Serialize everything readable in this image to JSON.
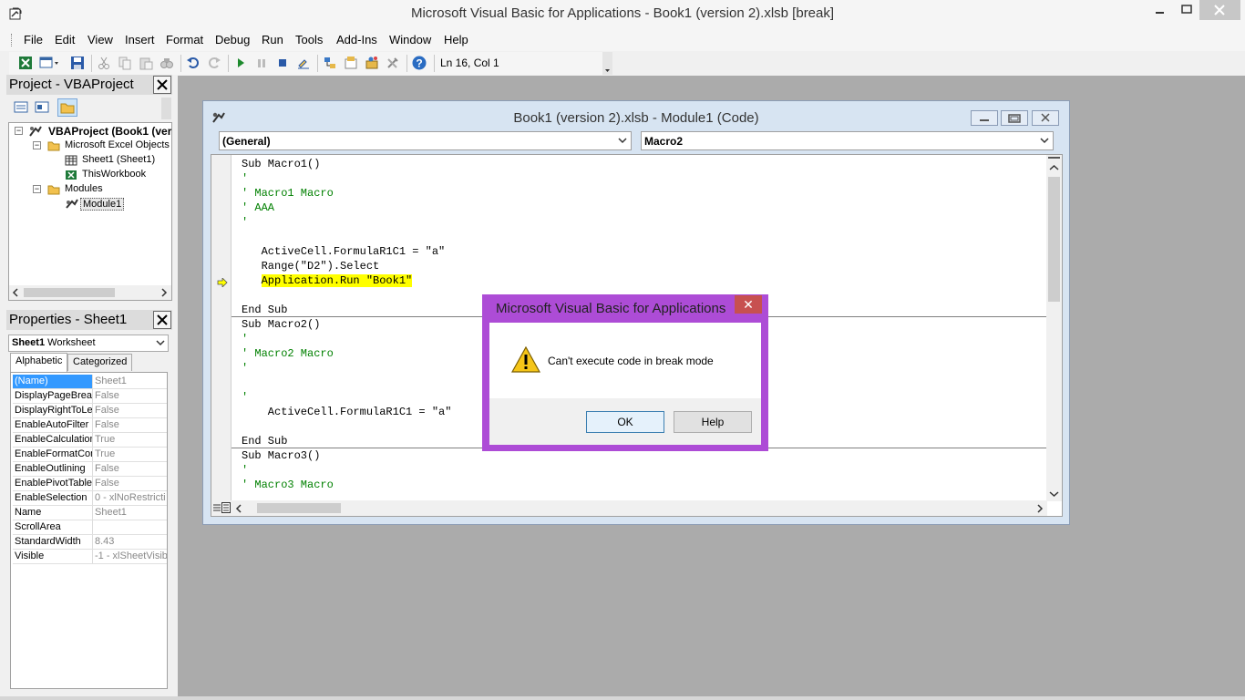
{
  "window": {
    "title": "Microsoft Visual Basic for Applications - Book1 (version 2).xlsb [break]",
    "controls": [
      "minimize",
      "maximize",
      "close"
    ]
  },
  "menu": {
    "items": [
      {
        "label": "File"
      },
      {
        "label": "Edit"
      },
      {
        "label": "View"
      },
      {
        "label": "Insert"
      },
      {
        "label": "Format"
      },
      {
        "label": "Debug"
      },
      {
        "label": "Run"
      },
      {
        "label": "Tools"
      },
      {
        "label": "Add-Ins"
      },
      {
        "label": "Window"
      },
      {
        "label": "Help"
      }
    ]
  },
  "toolbar": {
    "position_text": "Ln 16, Col 1",
    "icons": [
      "excel-icon",
      "insert-module-icon",
      "save-icon",
      "cut-icon",
      "copy-icon",
      "paste-icon",
      "find-icon",
      "undo-icon",
      "redo-icon",
      "run-icon",
      "break-icon",
      "reset-icon",
      "design-mode-icon",
      "project-explorer-icon",
      "properties-icon",
      "object-browser-icon",
      "toolbox-icon",
      "help-icon"
    ]
  },
  "project": {
    "title": "Project - VBAProject",
    "tree": {
      "root": "VBAProject (Book1 (ver",
      "excel_objects": "Microsoft Excel Objects",
      "sheet1": "Sheet1 (Sheet1)",
      "thisworkbook": "ThisWorkbook",
      "modules": "Modules",
      "module1": "Module1"
    }
  },
  "properties": {
    "title": "Properties - Sheet1",
    "object_name": "Sheet1",
    "object_type": "Worksheet",
    "tabs": [
      "Alphabetic",
      "Categorized"
    ],
    "rows": [
      {
        "name": "(Name)",
        "value": "Sheet1"
      },
      {
        "name": "DisplayPageBreak",
        "value": "False"
      },
      {
        "name": "DisplayRightToLef",
        "value": "False"
      },
      {
        "name": "EnableAutoFilter",
        "value": "False"
      },
      {
        "name": "EnableCalculation",
        "value": "True"
      },
      {
        "name": "EnableFormatCon",
        "value": "True"
      },
      {
        "name": "EnableOutlining",
        "value": "False"
      },
      {
        "name": "EnablePivotTable",
        "value": "False"
      },
      {
        "name": "EnableSelection",
        "value": "0 - xlNoRestricti"
      },
      {
        "name": "Name",
        "value": "Sheet1"
      },
      {
        "name": "ScrollArea",
        "value": ""
      },
      {
        "name": "StandardWidth",
        "value": "8.43"
      },
      {
        "name": "Visible",
        "value": "-1 - xlSheetVisib"
      }
    ]
  },
  "code_window": {
    "title": "Book1 (version 2).xlsb - Module1 (Code)",
    "object_combo": "(General)",
    "procedure_combo": "Macro2",
    "lines": [
      {
        "text": "Sub Macro1()",
        "kind": "code"
      },
      {
        "text": "'",
        "kind": "comment"
      },
      {
        "text": "' Macro1 Macro",
        "kind": "comment"
      },
      {
        "text": "' AAA",
        "kind": "comment"
      },
      {
        "text": "'",
        "kind": "comment"
      },
      {
        "text": "",
        "kind": "code"
      },
      {
        "text": "   ActiveCell.FormulaR1C1 = \"a\"",
        "kind": "code"
      },
      {
        "text": "   Range(\"D2\").Select",
        "kind": "code"
      },
      {
        "text": "   Application.Run \"Book1\"",
        "kind": "highlight"
      },
      {
        "text": "",
        "kind": "code"
      },
      {
        "text": "End Sub",
        "kind": "code"
      },
      {
        "text": "Sub Macro2()",
        "kind": "code"
      },
      {
        "text": "'",
        "kind": "comment"
      },
      {
        "text": "' Macro2 Macro",
        "kind": "comment"
      },
      {
        "text": "'",
        "kind": "comment"
      },
      {
        "text": "",
        "kind": "code"
      },
      {
        "text": "'",
        "kind": "comment"
      },
      {
        "text": "    ActiveCell.FormulaR1C1 = \"a\"",
        "kind": "code"
      },
      {
        "text": "",
        "kind": "code"
      },
      {
        "text": "End Sub",
        "kind": "code"
      },
      {
        "text": "Sub Macro3()",
        "kind": "code"
      },
      {
        "text": "'",
        "kind": "comment"
      },
      {
        "text": "' Macro3 Macro",
        "kind": "comment"
      }
    ]
  },
  "dialog": {
    "title": "Microsoft Visual Basic for Applications",
    "message": "Can't execute code in break mode",
    "ok_label": "OK",
    "help_label": "Help",
    "close_glyph": "✕",
    "accent": "#ad4cd6"
  }
}
